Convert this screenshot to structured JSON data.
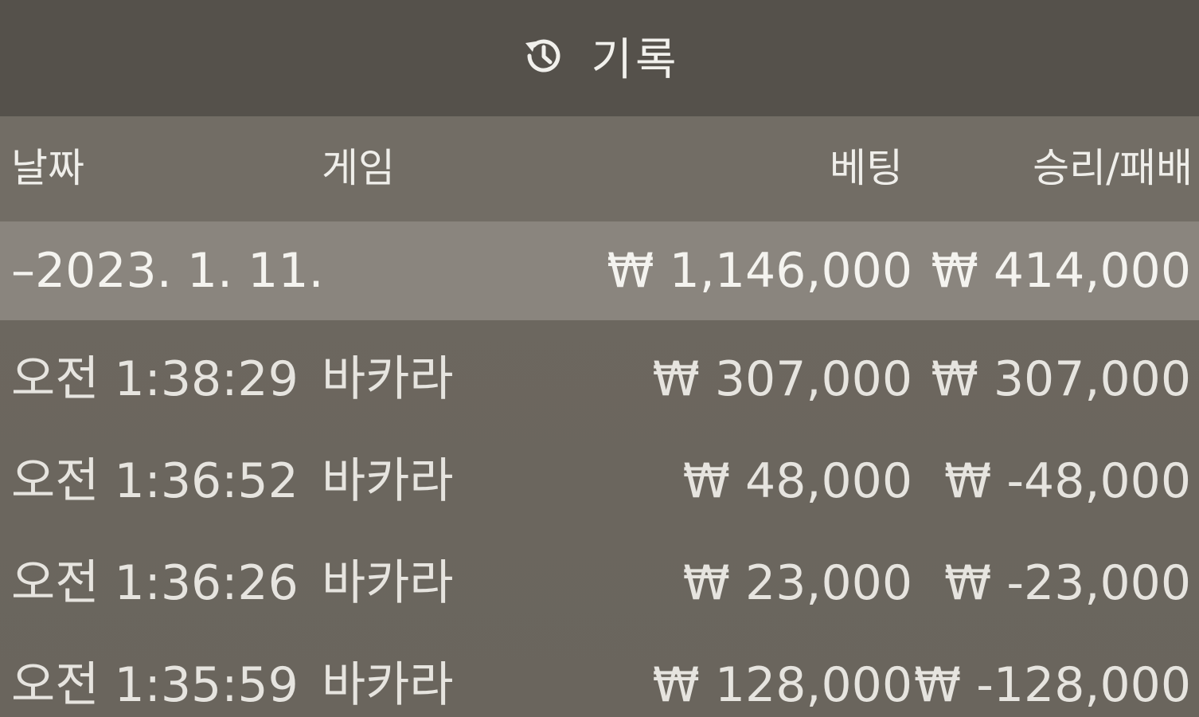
{
  "header": {
    "icon": "history-icon",
    "title": "기록"
  },
  "columns": {
    "date": "날짜",
    "game": "게임",
    "bet": "베팅",
    "win_loss": "승리/패배"
  },
  "summary": {
    "date": "–2023. 1. 11.",
    "bet": "₩ 1,146,000",
    "win_loss": "₩ 414,000"
  },
  "rows": [
    {
      "time": "오전 1:38:29",
      "game": "바카라",
      "bet": "₩ 307,000",
      "win_loss": "₩ 307,000"
    },
    {
      "time": "오전 1:36:52",
      "game": "바카라",
      "bet": "₩ 48,000",
      "win_loss": "₩ -48,000"
    },
    {
      "time": "오전 1:36:26",
      "game": "바카라",
      "bet": "₩ 23,000",
      "win_loss": "₩ -23,000"
    },
    {
      "time": "오전 1:35:59",
      "game": "바카라",
      "bet": "₩ 128,000",
      "win_loss": "₩ -128,000"
    }
  ]
}
